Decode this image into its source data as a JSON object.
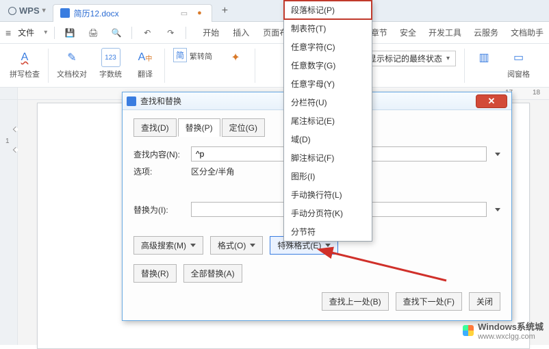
{
  "titlebar": {
    "logo": "WPS",
    "doc_name": "简历12.docx",
    "plus": "+"
  },
  "menu": {
    "file": "文件",
    "tabs": [
      "开始",
      "插入",
      "页面布局"
    ],
    "right": [
      "章节",
      "安全",
      "开发工具",
      "云服务",
      "文档助手"
    ]
  },
  "ribbon": {
    "items": {
      "spellcheck": {
        "label": "拼写检查",
        "glyph": "A ̲"
      },
      "doc_proof": {
        "label": "文档校对",
        "glyph": "✎"
      },
      "word_count": {
        "label": "字数统",
        "glyph": "123"
      },
      "trad_simp": {
        "label": "繁转简",
        "glyph": "繁"
      },
      "translate": {
        "label": "翻译",
        "glyph": "A⇄"
      },
      "special": {
        "label": "",
        "glyph": "✦"
      },
      "view_pane": {
        "label": "阅窗格",
        "glyph": "▭"
      },
      "nav_pane": {
        "label": "",
        "glyph": "▥"
      }
    },
    "status_dd": "显示标记的最终状态"
  },
  "ruler": {
    "h_marks": {
      "17": 712,
      "18": 752
    },
    "v_marks": {
      "1": 55
    }
  },
  "dialog": {
    "title": "查找和替换",
    "tabs": {
      "find": "查找(D)",
      "replace": "替换(P)",
      "goto": "定位(G)"
    },
    "find_label": "查找内容(N):",
    "find_value": "^p",
    "options_label": "选项:",
    "options_value": "区分全/半角",
    "replace_label": "替换为(I):",
    "replace_value": "",
    "adv_search": "高级搜索(M)",
    "format": "格式(O)",
    "special": "特殊格式(E)",
    "replace_btn": "替换(R)",
    "replace_all": "全部替换(A)",
    "find_prev": "查找上一处(B)",
    "find_next": "查找下一处(F)",
    "close": "关闭"
  },
  "popup": {
    "items": [
      "段落标记(P)",
      "制表符(T)",
      "任意字符(C)",
      "任意数字(G)",
      "任意字母(Y)",
      "分栏符(U)",
      "尾注标记(E)",
      "域(D)",
      "脚注标记(F)",
      "图形(I)",
      "手动换行符(L)",
      "手动分页符(K)",
      "分节符"
    ]
  },
  "watermark": {
    "brand": "Windows系统城",
    "url": "www.wxclgg.com"
  }
}
